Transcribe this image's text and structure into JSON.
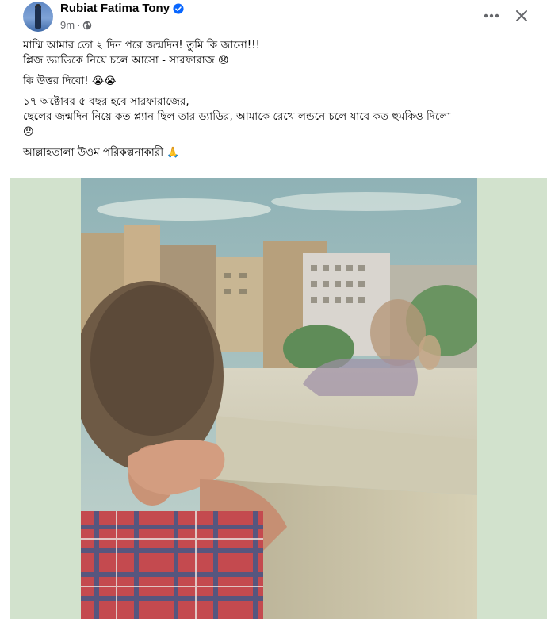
{
  "post": {
    "author": "Rubiat Fatima Tony",
    "timestamp": "9m",
    "separator": "·",
    "privacy_icon": "globe-icon",
    "verified_icon": "verified-badge-icon",
    "more_icon": "more-horizontal-icon",
    "close_icon": "close-icon",
    "paragraphs": [
      {
        "lines": [
          {
            "text": "মাম্মি আমার তো ২ দিন পরে জন্মদিন!  তুমি কি জানো!!!",
            "emoji": ""
          },
          {
            "text": "প্লিজ ড্যাডিকে নিয়ে চলে আসো - সারফারাজ ",
            "emoji": "😞"
          }
        ]
      },
      {
        "lines": [
          {
            "text": "কি উত্তর দিবো! ",
            "emoji": "😭😭"
          }
        ]
      },
      {
        "lines": [
          {
            "text": "১৭ অক্টোবর ৫ বছর হবে সারফারাজের,",
            "emoji": ""
          },
          {
            "text": "ছেলের জন্মদিন নিয়ে  কত প্ল্যান  ছিল তার ড্যাডির,  আমাকে রেখে লন্ডনে চলে যাবে কত হুমকিও দিলো",
            "emoji": ""
          },
          {
            "text": "",
            "emoji": "😞"
          }
        ]
      },
      {
        "lines": [
          {
            "text": "আল্লাহতালা উওম পরিকল্পনাকারী ",
            "emoji": "🙏"
          }
        ]
      }
    ],
    "photo_description_icon": "photo-child-at-window"
  },
  "colors": {
    "text": "#050505",
    "secondary_text": "#65676b",
    "verified": "#0866ff",
    "photo_background": "#d2e2cd"
  }
}
